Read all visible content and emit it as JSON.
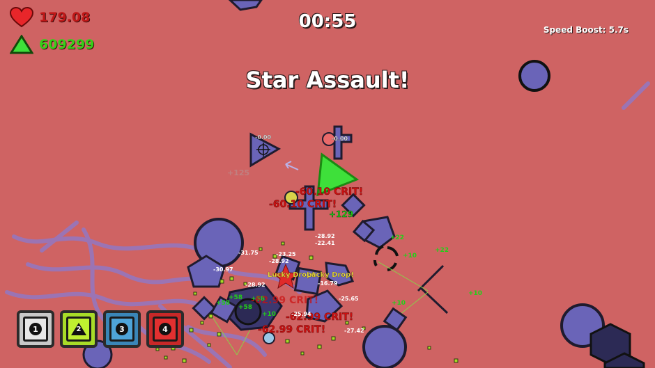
{
  "hud": {
    "health": "179.08",
    "score": "609299",
    "timer": "00:55",
    "speed_boost": "Speed Boost: 5.7s",
    "announcement": "Star Assault!"
  },
  "abilities": [
    {
      "label": "1",
      "color": "#c8c8c8",
      "inner": "#e6e6e6",
      "shape": "circle"
    },
    {
      "label": "2",
      "color": "#a8dc28",
      "inner": "#bff030",
      "shape": "triangle"
    },
    {
      "label": "3",
      "color": "#3a86b8",
      "inner": "#4ea4d8",
      "shape": "circle"
    },
    {
      "label": "4",
      "color": "#c82828",
      "inner": "#e23030",
      "shape": "circle"
    }
  ],
  "floating_text": {
    "crit_1": "-60.10 CRIT!",
    "crit_2": "-60.10 CRIT!",
    "crit_3": "-62.99 CRIT!",
    "crit_4": "-62.99 CRIT!",
    "crit_5": "-62.99 CRIT!",
    "lucky_1": "Lucky Drop!",
    "lucky_2": "Lucky Drop!",
    "dmg_1": "-0.00",
    "dmg_2": "-0.00",
    "dmg_3": "-28.92",
    "dmg_4": "-22.41",
    "dmg_5": "-31.75",
    "dmg_6": "-30.97",
    "dmg_7": "-23.25",
    "dmg_8": "-28.92",
    "dmg_9": "-16.79",
    "dmg_10": "-25.65",
    "dmg_11": "-25.94",
    "dmg_12": "-27.42",
    "dmg_13": "-28.92",
    "heal_1": "+125",
    "heal_2": "+129",
    "heal_3": "+22",
    "heal_4": "+10",
    "heal_5": "+10",
    "heal_6": "+10",
    "heal_7": "+58",
    "heal_8": "+58",
    "heal_9": "+58",
    "heal_10": "+58",
    "heal_11": "+22",
    "heal_12": "+10"
  },
  "colors": {
    "background": "#cf6363",
    "enemy": "#6a64b8",
    "enemy_outline": "#1f1b2e",
    "player": "#3ee03a",
    "health_text": "#c01818",
    "score_text": "#34d018",
    "crit_text": "#cc1010",
    "heal_text": "#22d018"
  }
}
